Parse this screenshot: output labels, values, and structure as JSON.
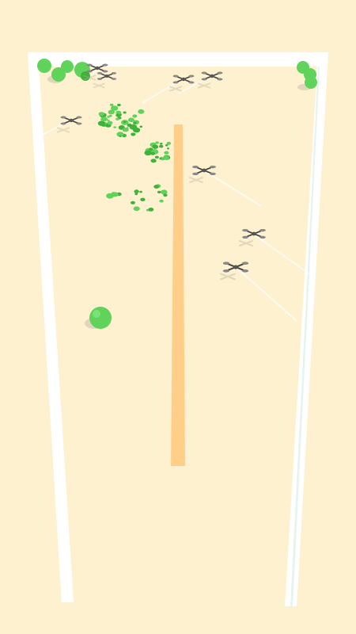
{
  "game": {
    "background_color": "#fdf1cf",
    "wall_color": "#ffffff",
    "path_color": "#ffcf8a",
    "tree_color": "#5fd35a",
    "tree_shade_color": "#3fb23a",
    "shadow_color": "#d6ccb5",
    "trail_color": "#ffffff"
  },
  "entities": {
    "player_ball": "green-ball",
    "enemies": "propeller-drone",
    "obstacles": "round-tree",
    "debris": "leaf-particles"
  },
  "hud": {
    "stage_label": ""
  }
}
